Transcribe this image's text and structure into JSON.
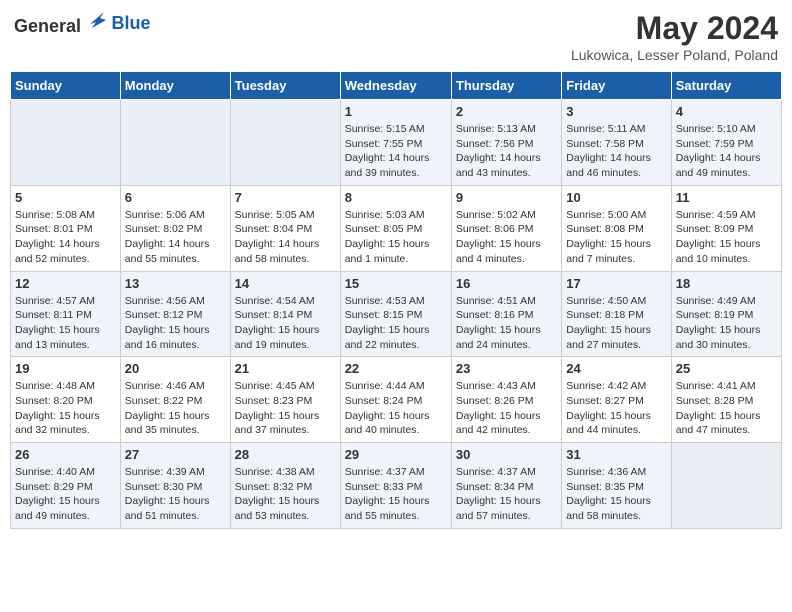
{
  "header": {
    "logo_general": "General",
    "logo_blue": "Blue",
    "title": "May 2024",
    "subtitle": "Lukowica, Lesser Poland, Poland"
  },
  "days_of_week": [
    "Sunday",
    "Monday",
    "Tuesday",
    "Wednesday",
    "Thursday",
    "Friday",
    "Saturday"
  ],
  "weeks": [
    {
      "days": [
        {
          "num": "",
          "sunrise": "",
          "sunset": "",
          "daylight": ""
        },
        {
          "num": "",
          "sunrise": "",
          "sunset": "",
          "daylight": ""
        },
        {
          "num": "",
          "sunrise": "",
          "sunset": "",
          "daylight": ""
        },
        {
          "num": "1",
          "sunrise": "Sunrise: 5:15 AM",
          "sunset": "Sunset: 7:55 PM",
          "daylight": "Daylight: 14 hours and 39 minutes."
        },
        {
          "num": "2",
          "sunrise": "Sunrise: 5:13 AM",
          "sunset": "Sunset: 7:56 PM",
          "daylight": "Daylight: 14 hours and 43 minutes."
        },
        {
          "num": "3",
          "sunrise": "Sunrise: 5:11 AM",
          "sunset": "Sunset: 7:58 PM",
          "daylight": "Daylight: 14 hours and 46 minutes."
        },
        {
          "num": "4",
          "sunrise": "Sunrise: 5:10 AM",
          "sunset": "Sunset: 7:59 PM",
          "daylight": "Daylight: 14 hours and 49 minutes."
        }
      ]
    },
    {
      "days": [
        {
          "num": "5",
          "sunrise": "Sunrise: 5:08 AM",
          "sunset": "Sunset: 8:01 PM",
          "daylight": "Daylight: 14 hours and 52 minutes."
        },
        {
          "num": "6",
          "sunrise": "Sunrise: 5:06 AM",
          "sunset": "Sunset: 8:02 PM",
          "daylight": "Daylight: 14 hours and 55 minutes."
        },
        {
          "num": "7",
          "sunrise": "Sunrise: 5:05 AM",
          "sunset": "Sunset: 8:04 PM",
          "daylight": "Daylight: 14 hours and 58 minutes."
        },
        {
          "num": "8",
          "sunrise": "Sunrise: 5:03 AM",
          "sunset": "Sunset: 8:05 PM",
          "daylight": "Daylight: 15 hours and 1 minute."
        },
        {
          "num": "9",
          "sunrise": "Sunrise: 5:02 AM",
          "sunset": "Sunset: 8:06 PM",
          "daylight": "Daylight: 15 hours and 4 minutes."
        },
        {
          "num": "10",
          "sunrise": "Sunrise: 5:00 AM",
          "sunset": "Sunset: 8:08 PM",
          "daylight": "Daylight: 15 hours and 7 minutes."
        },
        {
          "num": "11",
          "sunrise": "Sunrise: 4:59 AM",
          "sunset": "Sunset: 8:09 PM",
          "daylight": "Daylight: 15 hours and 10 minutes."
        }
      ]
    },
    {
      "days": [
        {
          "num": "12",
          "sunrise": "Sunrise: 4:57 AM",
          "sunset": "Sunset: 8:11 PM",
          "daylight": "Daylight: 15 hours and 13 minutes."
        },
        {
          "num": "13",
          "sunrise": "Sunrise: 4:56 AM",
          "sunset": "Sunset: 8:12 PM",
          "daylight": "Daylight: 15 hours and 16 minutes."
        },
        {
          "num": "14",
          "sunrise": "Sunrise: 4:54 AM",
          "sunset": "Sunset: 8:14 PM",
          "daylight": "Daylight: 15 hours and 19 minutes."
        },
        {
          "num": "15",
          "sunrise": "Sunrise: 4:53 AM",
          "sunset": "Sunset: 8:15 PM",
          "daylight": "Daylight: 15 hours and 22 minutes."
        },
        {
          "num": "16",
          "sunrise": "Sunrise: 4:51 AM",
          "sunset": "Sunset: 8:16 PM",
          "daylight": "Daylight: 15 hours and 24 minutes."
        },
        {
          "num": "17",
          "sunrise": "Sunrise: 4:50 AM",
          "sunset": "Sunset: 8:18 PM",
          "daylight": "Daylight: 15 hours and 27 minutes."
        },
        {
          "num": "18",
          "sunrise": "Sunrise: 4:49 AM",
          "sunset": "Sunset: 8:19 PM",
          "daylight": "Daylight: 15 hours and 30 minutes."
        }
      ]
    },
    {
      "days": [
        {
          "num": "19",
          "sunrise": "Sunrise: 4:48 AM",
          "sunset": "Sunset: 8:20 PM",
          "daylight": "Daylight: 15 hours and 32 minutes."
        },
        {
          "num": "20",
          "sunrise": "Sunrise: 4:46 AM",
          "sunset": "Sunset: 8:22 PM",
          "daylight": "Daylight: 15 hours and 35 minutes."
        },
        {
          "num": "21",
          "sunrise": "Sunrise: 4:45 AM",
          "sunset": "Sunset: 8:23 PM",
          "daylight": "Daylight: 15 hours and 37 minutes."
        },
        {
          "num": "22",
          "sunrise": "Sunrise: 4:44 AM",
          "sunset": "Sunset: 8:24 PM",
          "daylight": "Daylight: 15 hours and 40 minutes."
        },
        {
          "num": "23",
          "sunrise": "Sunrise: 4:43 AM",
          "sunset": "Sunset: 8:26 PM",
          "daylight": "Daylight: 15 hours and 42 minutes."
        },
        {
          "num": "24",
          "sunrise": "Sunrise: 4:42 AM",
          "sunset": "Sunset: 8:27 PM",
          "daylight": "Daylight: 15 hours and 44 minutes."
        },
        {
          "num": "25",
          "sunrise": "Sunrise: 4:41 AM",
          "sunset": "Sunset: 8:28 PM",
          "daylight": "Daylight: 15 hours and 47 minutes."
        }
      ]
    },
    {
      "days": [
        {
          "num": "26",
          "sunrise": "Sunrise: 4:40 AM",
          "sunset": "Sunset: 8:29 PM",
          "daylight": "Daylight: 15 hours and 49 minutes."
        },
        {
          "num": "27",
          "sunrise": "Sunrise: 4:39 AM",
          "sunset": "Sunset: 8:30 PM",
          "daylight": "Daylight: 15 hours and 51 minutes."
        },
        {
          "num": "28",
          "sunrise": "Sunrise: 4:38 AM",
          "sunset": "Sunset: 8:32 PM",
          "daylight": "Daylight: 15 hours and 53 minutes."
        },
        {
          "num": "29",
          "sunrise": "Sunrise: 4:37 AM",
          "sunset": "Sunset: 8:33 PM",
          "daylight": "Daylight: 15 hours and 55 minutes."
        },
        {
          "num": "30",
          "sunrise": "Sunrise: 4:37 AM",
          "sunset": "Sunset: 8:34 PM",
          "daylight": "Daylight: 15 hours and 57 minutes."
        },
        {
          "num": "31",
          "sunrise": "Sunrise: 4:36 AM",
          "sunset": "Sunset: 8:35 PM",
          "daylight": "Daylight: 15 hours and 58 minutes."
        },
        {
          "num": "",
          "sunrise": "",
          "sunset": "",
          "daylight": ""
        }
      ]
    }
  ]
}
